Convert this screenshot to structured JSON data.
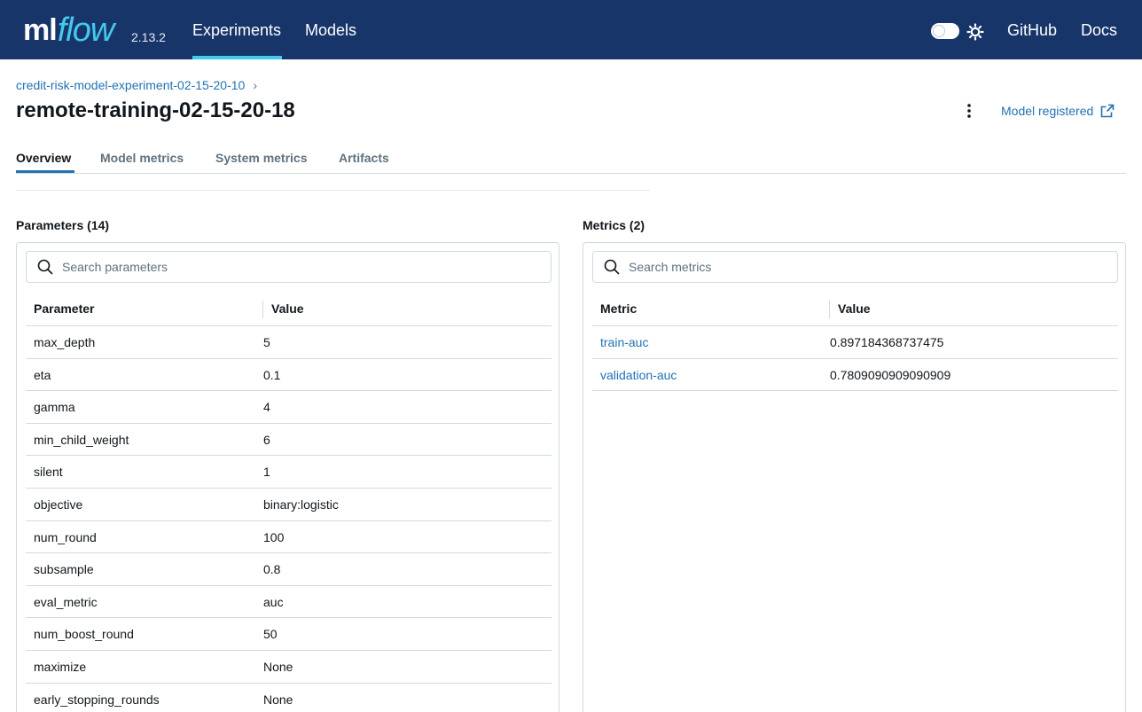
{
  "header": {
    "logo_ml": "ml",
    "logo_flow": "flow",
    "version": "2.13.2",
    "nav": [
      {
        "label": "Experiments",
        "active": true
      },
      {
        "label": "Models",
        "active": false
      }
    ],
    "right_links": [
      "GitHub",
      "Docs"
    ],
    "theme_icon": "sun-icon",
    "colors": {
      "bar": "#18356a",
      "accent": "#43c9ed"
    }
  },
  "breadcrumb": {
    "experiment": "credit-risk-model-experiment-02-15-20-10",
    "separator": "›"
  },
  "page_title": "remote-training-02-15-20-18",
  "model_registered": "Model registered",
  "tabs": [
    "Overview",
    "Model metrics",
    "System metrics",
    "Artifacts"
  ],
  "parameters": {
    "title": "Parameters (14)",
    "search_placeholder": "Search parameters",
    "headers": [
      "Parameter",
      "Value"
    ],
    "rows": [
      [
        "max_depth",
        "5"
      ],
      [
        "eta",
        "0.1"
      ],
      [
        "gamma",
        "4"
      ],
      [
        "min_child_weight",
        "6"
      ],
      [
        "silent",
        "1"
      ],
      [
        "objective",
        "binary:logistic"
      ],
      [
        "num_round",
        "100"
      ],
      [
        "subsample",
        "0.8"
      ],
      [
        "eval_metric",
        "auc"
      ],
      [
        "num_boost_round",
        "50"
      ],
      [
        "maximize",
        "None"
      ],
      [
        "early_stopping_rounds",
        "None"
      ]
    ]
  },
  "metrics": {
    "title": "Metrics (2)",
    "search_placeholder": "Search metrics",
    "headers": [
      "Metric",
      "Value"
    ],
    "rows": [
      [
        "train-auc",
        "0.897184368737475"
      ],
      [
        "validation-auc",
        "0.7809090909090909"
      ]
    ]
  },
  "link_color": "#2272b4"
}
